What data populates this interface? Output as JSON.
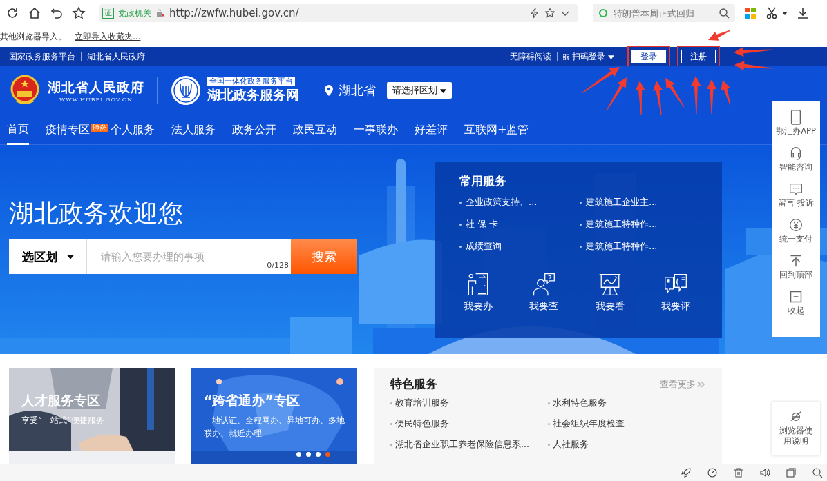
{
  "browser": {
    "address": {
      "badge": "证",
      "label": "党政机关",
      "url": "http://zwfw.hubei.gov.cn/"
    },
    "search": {
      "placeholder": "特朗普本周正式回归"
    },
    "bookmarks": [
      "其他浏览器导入。",
      "立即导入收藏夹..."
    ]
  },
  "topbar": {
    "links": [
      "国家政务服务平台",
      "湖北省人民政府"
    ],
    "accessibility": "无障碍阅读",
    "scan_login": "扫码登录",
    "buttons": [
      {
        "label": "登录",
        "kind": "light",
        "highlighted": true
      },
      {
        "label": "注册",
        "kind": "outline",
        "highlighted": true
      }
    ]
  },
  "header": {
    "gov_name": "湖北省人民政府",
    "gov_url": "WWW.HUBEI.GOV.CN",
    "platform_badge": "全国一体化政务服务平台",
    "site_name": "湖北政务服务网",
    "province": "湖北省",
    "region_select": "请选择区划"
  },
  "nav": [
    {
      "label": "首页",
      "selected": true
    },
    {
      "label": "疫情专区",
      "selected": false,
      "badge": "肺炎"
    },
    {
      "label": "个人服务",
      "selected": false
    },
    {
      "label": "法人服务",
      "selected": false
    },
    {
      "label": "政务公开",
      "selected": false
    },
    {
      "label": "政民互动",
      "selected": false
    },
    {
      "label": "一事联办",
      "selected": false
    },
    {
      "label": "好差评",
      "selected": false
    },
    {
      "label": "互联网+监管",
      "selected": false
    }
  ],
  "hero": {
    "title": "湖北政务欢迎您",
    "search": {
      "region": "选区划",
      "placeholder": "请输入您要办理的事项",
      "counter": "0/128",
      "button": "搜索"
    }
  },
  "common_services": {
    "title": "常用服务",
    "items": [
      "企业政策支持、...",
      "建筑施工企业主...",
      "社 保 卡",
      "建筑施工特种作...",
      "成绩查询",
      "建筑施工特种作..."
    ],
    "actions": [
      {
        "label": "我要办",
        "kind": "do"
      },
      {
        "label": "我要查",
        "kind": "query"
      },
      {
        "label": "我要看",
        "kind": "view"
      },
      {
        "label": "我要评",
        "kind": "rate"
      }
    ]
  },
  "side_tools": [
    {
      "label": "鄂汇办APP",
      "kind": "phone"
    },
    {
      "label": "智能咨询",
      "kind": "headset"
    },
    {
      "label": "留言 投诉",
      "kind": "message"
    },
    {
      "label": "统一支付",
      "kind": "yuan"
    },
    {
      "label": "回到顶部",
      "kind": "top"
    },
    {
      "label": "收起",
      "kind": "collapse"
    }
  ],
  "banners": [
    {
      "title": "人才服务专区",
      "subtitle": "享受“一站式”便捷服务"
    },
    {
      "title": "“跨省通办”专区",
      "subtitle": "一地认证、全程网办、异地可办、多地联办、就近办理",
      "carousel": [
        {
          "selected": false
        },
        {
          "selected": false
        },
        {
          "selected": false
        },
        {
          "selected": true
        }
      ]
    }
  ],
  "featured": {
    "title": "特色服务",
    "more": "查看更多",
    "items": [
      "教育培训服务",
      "水利特色服务",
      "便民特色服务",
      "社会组织年度检查",
      "湖北省企业职工养老保险信息系...",
      "人社服务"
    ]
  },
  "browser_help": "浏览器使用说明"
}
